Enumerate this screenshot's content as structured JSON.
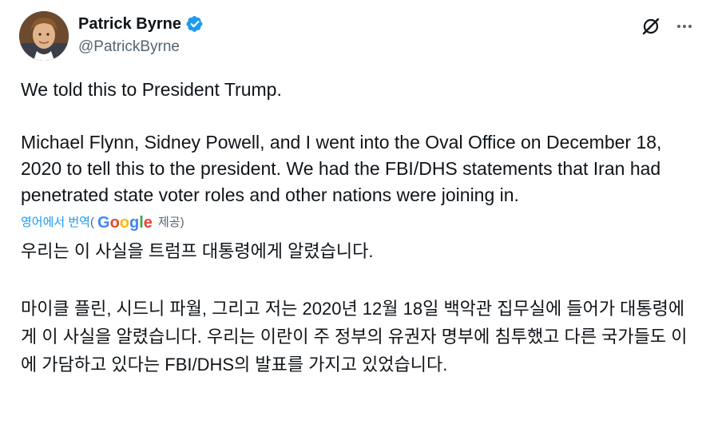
{
  "author": {
    "name": "Patrick Byrne",
    "handle": "@PatrickByrne",
    "verified": true,
    "badge_color": "#1d9bf0"
  },
  "actions": {
    "grok_icon": "grok-icon",
    "more_icon": "more-icon"
  },
  "tweet": {
    "paragraph_1": "We told this to President Trump.",
    "paragraph_2": "Michael Flynn, Sidney Powell, and I went into the Oval Office on December 18, 2020 to tell this to the president. We had the FBI/DHS statements that Iran had penetrated state voter roles and other nations were joining in."
  },
  "translation": {
    "link_label": "영어에서 번역",
    "open_paren": "(",
    "provider": "Google",
    "provided_label": "제공)",
    "paragraph_1": "우리는 이 사실을 트럼프 대통령에게 알렸습니다.",
    "paragraph_2": "마이클 플린, 시드니 파월, 그리고 저는 2020년 12월 18일 백악관 집무실에 들어가 대통령에게 이 사실을 알렸습니다. 우리는 이란이 주 정부의 유권자 명부에 침투했고 다른 국가들도 이에 가담하고 있다는 FBI/DHS의 발표를 가지고 있었습니다."
  },
  "colors": {
    "text": "#0f1419",
    "secondary": "#536471",
    "link": "#1d9bf0"
  }
}
